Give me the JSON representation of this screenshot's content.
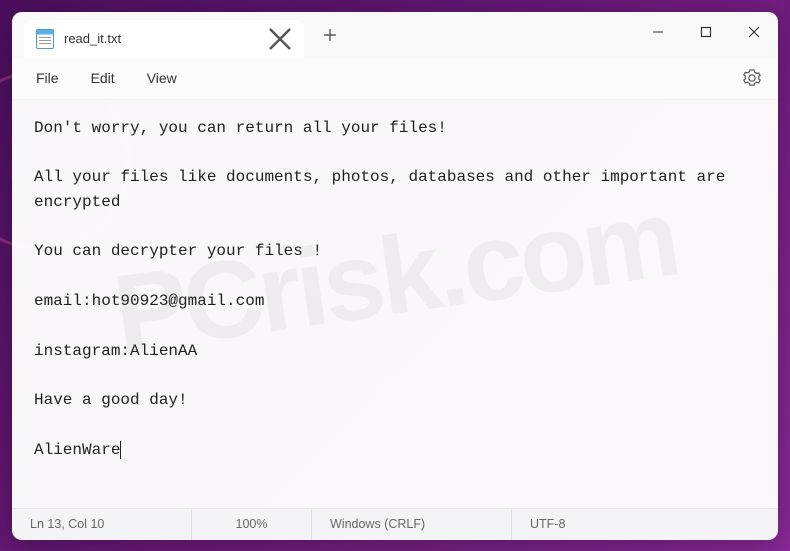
{
  "tab": {
    "title": "read_it.txt"
  },
  "menu": {
    "file": "File",
    "edit": "Edit",
    "view": "View"
  },
  "content": {
    "text": "Don't worry, you can return all your files!\n\nAll your files like documents, photos, databases and other important are encrypted\n\nYou can decrypter your files !\n\nemail:hot90923@gmail.com\n\ninstagram:AlienAA\n\nHave a good day!\n\nAlienWare"
  },
  "status": {
    "position": "Ln 13, Col 10",
    "zoom": "100%",
    "lineending": "Windows (CRLF)",
    "encoding": "UTF-8"
  }
}
